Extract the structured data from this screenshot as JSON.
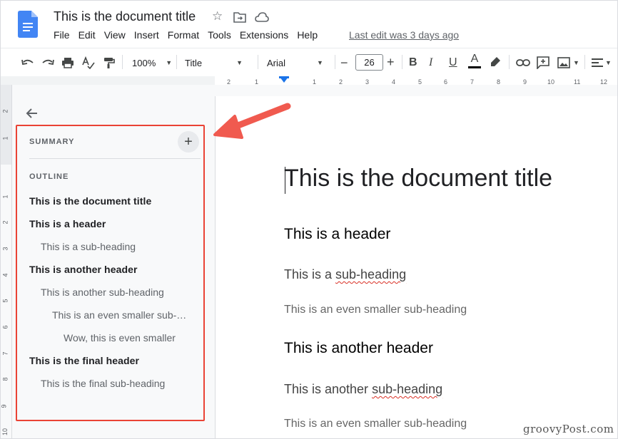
{
  "doc": {
    "title": "This is the document title",
    "menu": [
      "File",
      "Edit",
      "View",
      "Insert",
      "Format",
      "Tools",
      "Extensions",
      "Help"
    ],
    "last_edit": "Last edit was 3 days ago"
  },
  "toolbar": {
    "zoom": "100%",
    "style": "Title",
    "font": "Arial",
    "font_size": "26",
    "minus": "−",
    "plus": "+",
    "bold": "B",
    "italic": "I",
    "underline": "U",
    "text_color": "A"
  },
  "ruler": {
    "ticks": [
      "2",
      "1",
      "1",
      "2",
      "3",
      "4",
      "5",
      "6",
      "7",
      "8",
      "9",
      "10",
      "11",
      "12"
    ],
    "vticks": [
      "2",
      "1",
      "1",
      "2",
      "3",
      "4",
      "5",
      "6",
      "7",
      "8",
      "9",
      "10"
    ]
  },
  "outline_panel": {
    "summary_label": "SUMMARY",
    "add_summary": "+",
    "outline_label": "OUTLINE",
    "items": [
      {
        "text": "This is the document title",
        "level": 0
      },
      {
        "text": "This is a header",
        "level": 0
      },
      {
        "text": "This is a sub-heading",
        "level": 1
      },
      {
        "text": "This is another header",
        "level": 0
      },
      {
        "text": "This is another sub-heading",
        "level": 1
      },
      {
        "text": "This is an even smaller sub-…",
        "level": 2
      },
      {
        "text": "Wow, this is even smaller",
        "level": 3
      },
      {
        "text": "This is the final header",
        "level": 0
      },
      {
        "text": "This is the final sub-heading",
        "level": 1
      }
    ]
  },
  "document": {
    "title": "This is the document title",
    "h1": "This is a header",
    "h2a_pre": "This is a ",
    "h2a_word": "sub-heading",
    "h3a": "This is an even smaller sub-heading",
    "h1b": "This is another header",
    "h2b_pre": "This is another ",
    "h2b_word": "sub-heading",
    "h3b": "This is an even smaller sub-heading"
  },
  "watermark": "groovyPost.com",
  "colors": {
    "accent": "#1a73e8",
    "highlight_box": "#ea4335",
    "arrow": "#f05a4f"
  }
}
